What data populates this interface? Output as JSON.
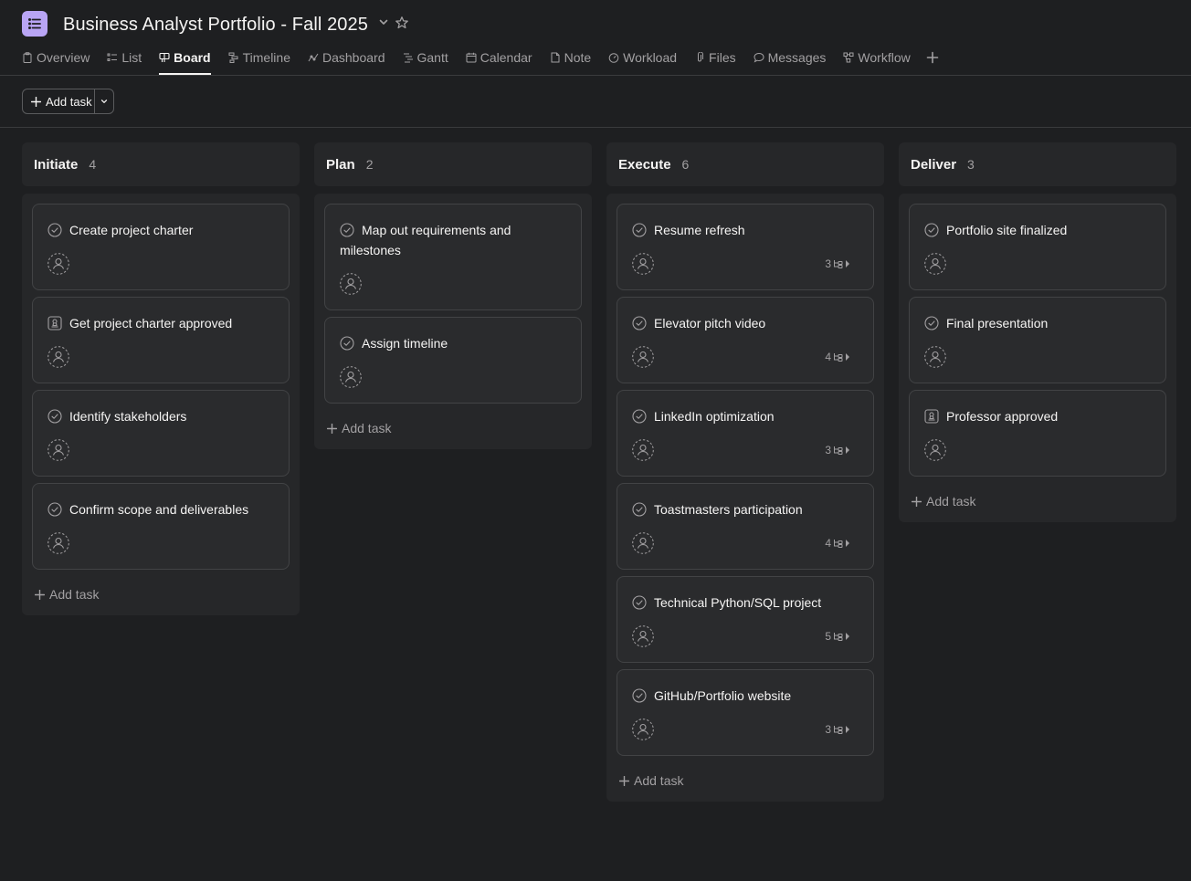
{
  "project": {
    "title": "Business Analyst Portfolio - Fall 2025",
    "icon": "list-icon",
    "accent": "#b9a5f5"
  },
  "tabs": [
    {
      "label": "Overview",
      "icon": "clipboard-icon",
      "active": false
    },
    {
      "label": "List",
      "icon": "list-icon",
      "active": false
    },
    {
      "label": "Board",
      "icon": "board-icon",
      "active": true
    },
    {
      "label": "Timeline",
      "icon": "timeline-icon",
      "active": false
    },
    {
      "label": "Dashboard",
      "icon": "chart-icon",
      "active": false
    },
    {
      "label": "Gantt",
      "icon": "gantt-icon",
      "active": false
    },
    {
      "label": "Calendar",
      "icon": "calendar-icon",
      "active": false
    },
    {
      "label": "Note",
      "icon": "note-icon",
      "active": false
    },
    {
      "label": "Workload",
      "icon": "gauge-icon",
      "active": false
    },
    {
      "label": "Files",
      "icon": "paperclip-icon",
      "active": false
    },
    {
      "label": "Messages",
      "icon": "chat-icon",
      "active": false
    },
    {
      "label": "Workflow",
      "icon": "workflow-icon",
      "active": false
    }
  ],
  "toolbar": {
    "add_task_label": "Add task"
  },
  "columns": [
    {
      "name": "Initiate",
      "count": "4",
      "cards": [
        {
          "title": "Create project charter",
          "type": "task"
        },
        {
          "title": "Get project charter approved",
          "type": "approval"
        },
        {
          "title": "Identify stakeholders",
          "type": "task"
        },
        {
          "title": "Confirm scope and deliverables",
          "type": "task"
        }
      ],
      "add_label": "Add task"
    },
    {
      "name": "Plan",
      "count": "2",
      "cards": [
        {
          "title": "Map out requirements and milestones",
          "type": "task"
        },
        {
          "title": "Assign timeline",
          "type": "task"
        }
      ],
      "add_label": "Add task"
    },
    {
      "name": "Execute",
      "count": "6",
      "cards": [
        {
          "title": "Resume refresh",
          "type": "task",
          "subtasks": "3"
        },
        {
          "title": "Elevator pitch video",
          "type": "task",
          "subtasks": "4"
        },
        {
          "title": "LinkedIn optimization",
          "type": "task",
          "subtasks": "3"
        },
        {
          "title": "Toastmasters participation",
          "type": "task",
          "subtasks": "4"
        },
        {
          "title": "Technical Python/SQL project",
          "type": "task",
          "subtasks": "5"
        },
        {
          "title": "GitHub/Portfolio website",
          "type": "task",
          "subtasks": "3"
        }
      ],
      "add_label": "Add task"
    },
    {
      "name": "Deliver",
      "count": "3",
      "cards": [
        {
          "title": "Portfolio site finalized",
          "type": "task"
        },
        {
          "title": "Final presentation",
          "type": "task"
        },
        {
          "title": "Professor approved",
          "type": "approval"
        }
      ],
      "add_label": "Add task"
    }
  ]
}
